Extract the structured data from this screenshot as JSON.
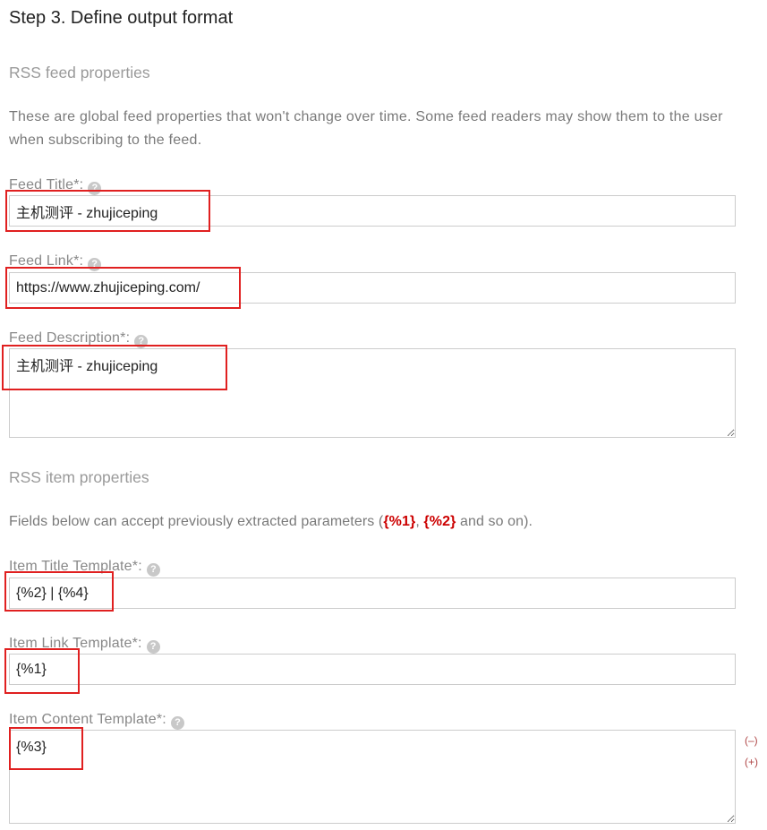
{
  "page": {
    "heading": "Step 3. Define output format",
    "help_glyph": "?"
  },
  "feed_section": {
    "title": "RSS feed properties",
    "description": "These are global feed properties that won't change over time. Some feed readers may show them to the user when subscribing to the feed.",
    "fields": {
      "title": {
        "label": "Feed Title*:",
        "value": "主机测评 - zhujiceping"
      },
      "link": {
        "label": "Feed Link*:",
        "value": "https://www.zhujiceping.com/"
      },
      "description": {
        "label": "Feed Description*:",
        "value": "主机测评 - zhujiceping"
      }
    }
  },
  "item_section": {
    "title": "RSS item properties",
    "hint": {
      "prefix": "Fields below can accept previously extracted parameters (",
      "param_1": "{%1}",
      "separator": ", ",
      "param_2": "{%2}",
      "suffix": " and so on)."
    },
    "fields": {
      "title_template": {
        "label": "Item Title Template*:",
        "value": "{%2} | {%4}"
      },
      "link_template": {
        "label": "Item Link Template*:",
        "value": "{%1}"
      },
      "content_template": {
        "label": "Item Content Template*:",
        "value": "{%3}"
      }
    },
    "content_controls": {
      "shrink": "(–)",
      "grow": "(+)"
    }
  },
  "colors": {
    "heading_text": "#222222",
    "muted_text": "#888888",
    "parameter_highlight": "#cc0000",
    "annotation_box": "#e02020",
    "input_border": "#cccccc"
  }
}
